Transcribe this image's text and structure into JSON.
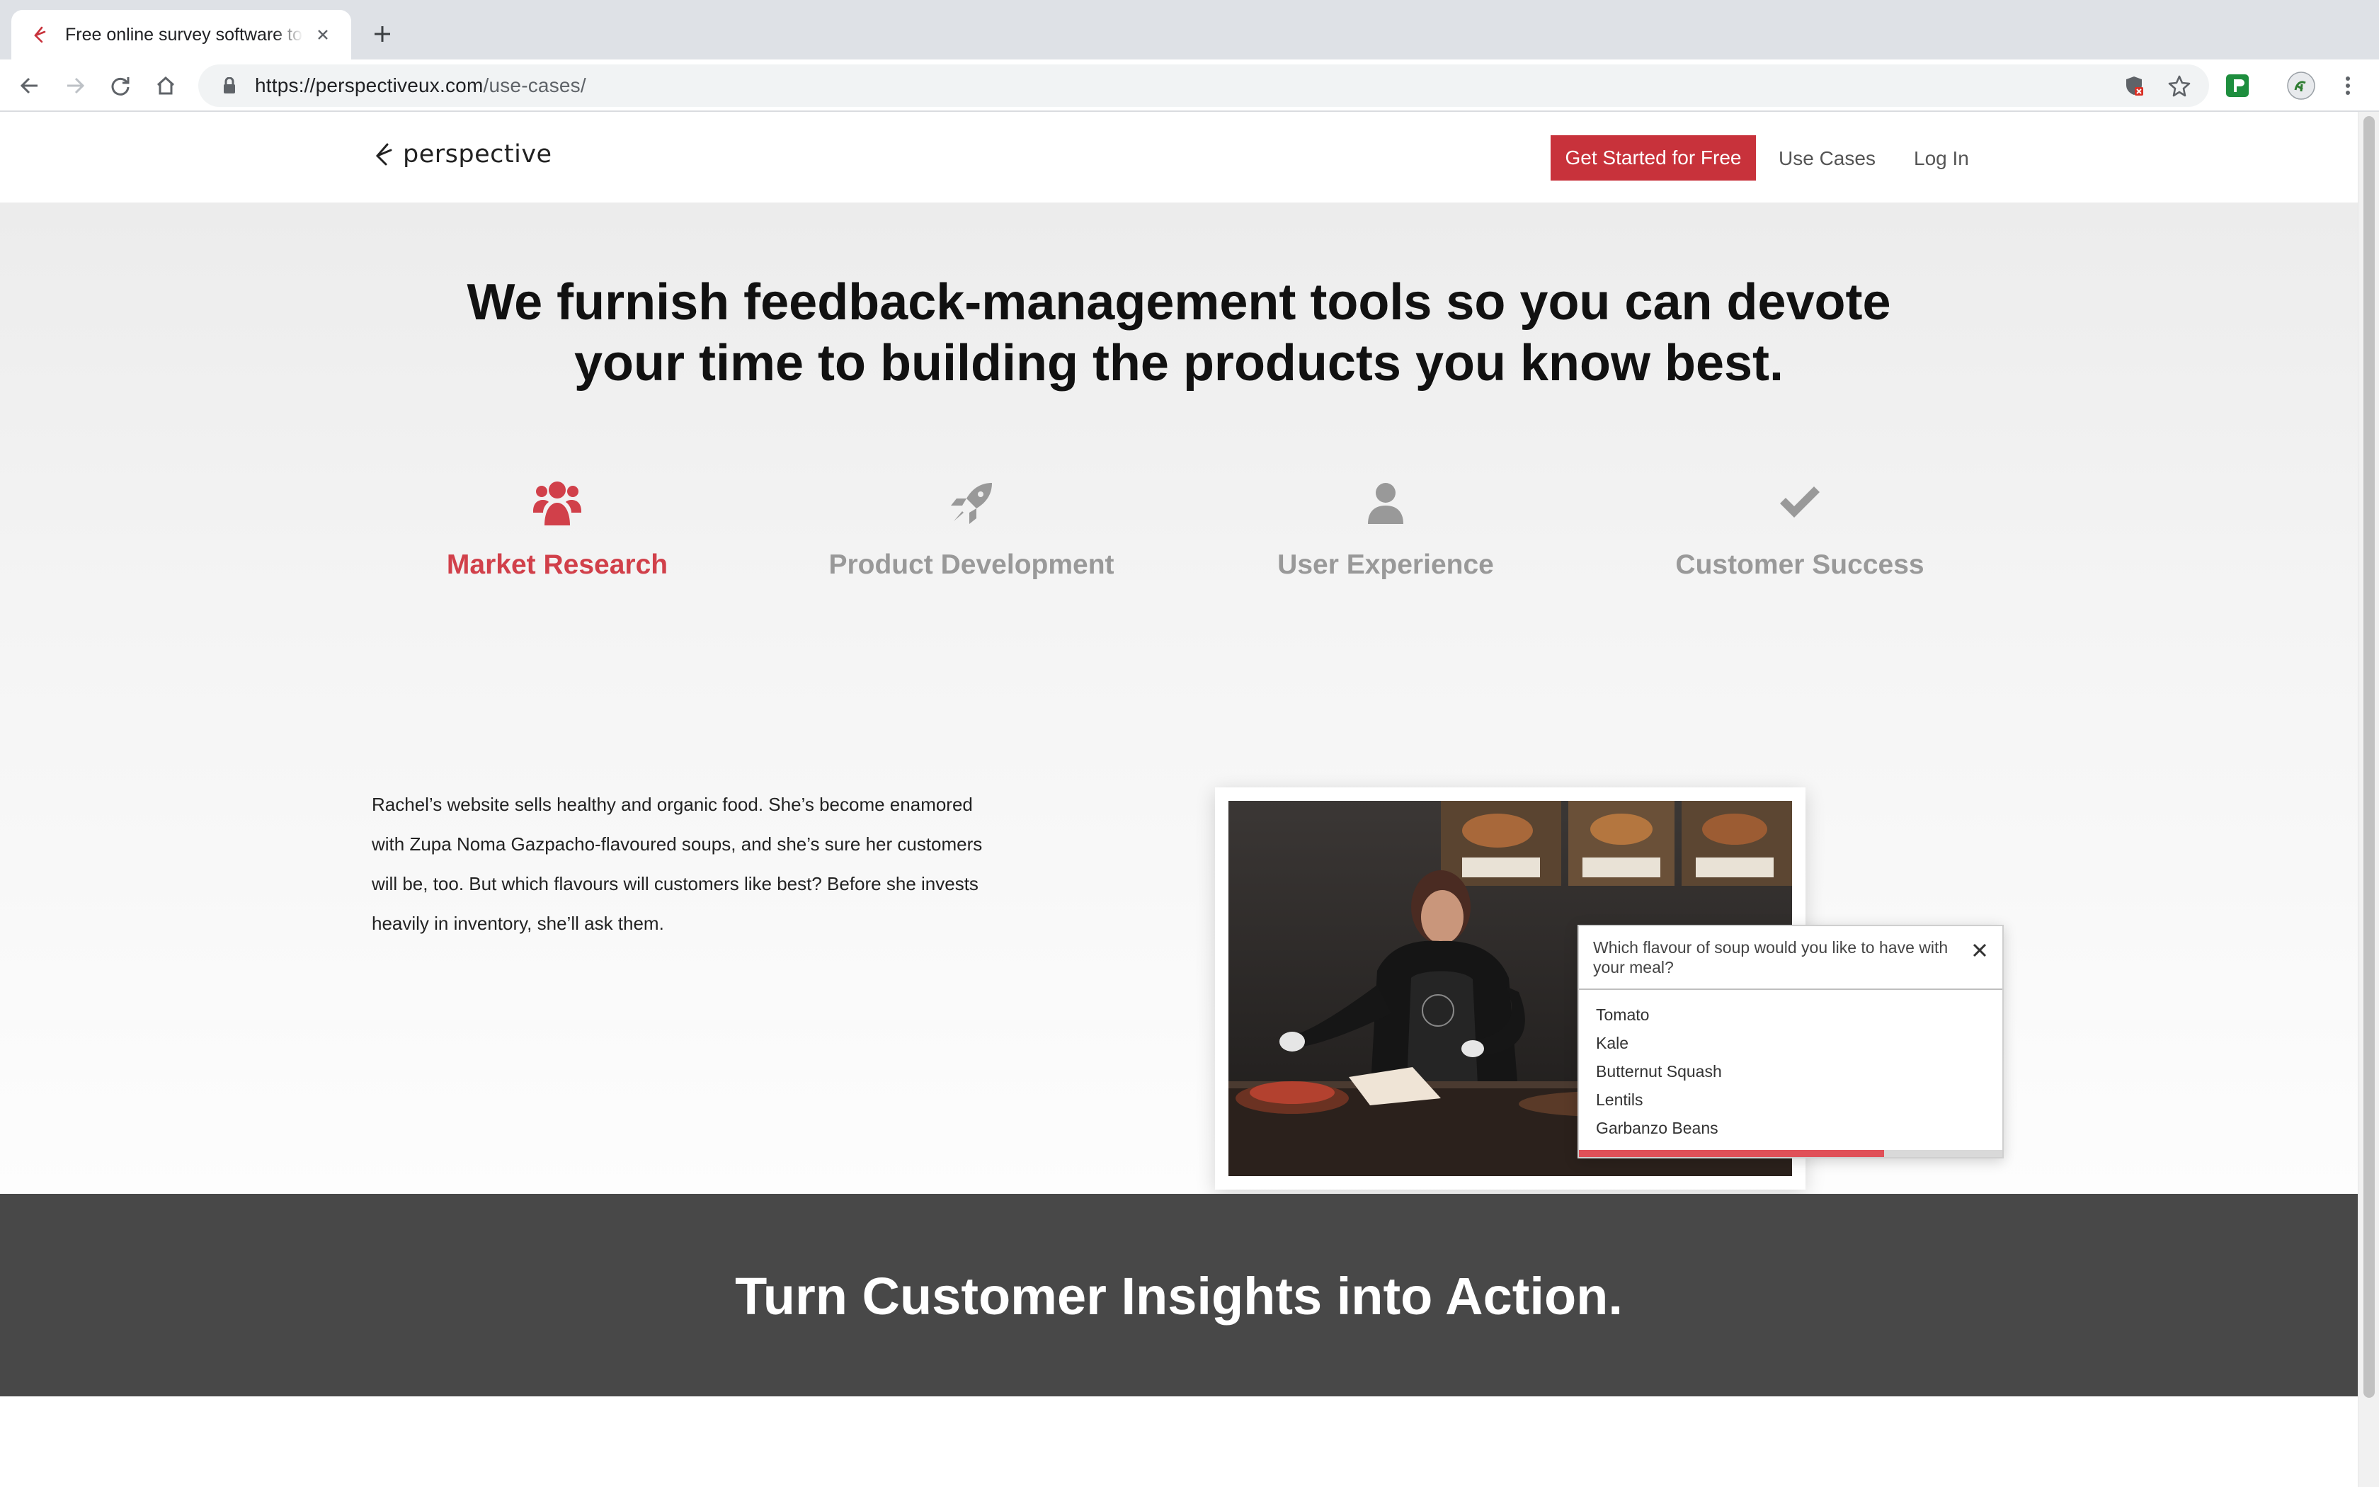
{
  "browser": {
    "tab_title": "Free online survey software to",
    "url_host": "https://perspectiveux.com",
    "url_path": "/use-cases/",
    "accent_color": "#c8323b"
  },
  "header": {
    "logo_text": "perspective",
    "cta_label": "Get Started for Free",
    "nav": [
      "Use Cases",
      "Log In"
    ]
  },
  "hero": {
    "headline_line1": "We furnish feedback-management tools so you can devote",
    "headline_line2": "your time to building the products you know best."
  },
  "categories": [
    {
      "label": "Market Research",
      "icon": "users-icon",
      "active": true
    },
    {
      "label": "Product Development",
      "icon": "rocket-icon",
      "active": false
    },
    {
      "label": "User Experience",
      "icon": "user-icon",
      "active": false
    },
    {
      "label": "Customer Success",
      "icon": "checkmark-icon",
      "active": false
    }
  ],
  "story": {
    "line1": "Rachel’s website sells healthy and organic food. She’s become enamored",
    "line2": "with Zupa Noma Gazpacho-flavoured soups, and she’s sure her customers",
    "line3": "will be, too. But which flavours will customers like best? Before she invests",
    "line4": "heavily in inventory, she’ll ask them."
  },
  "survey": {
    "question": "Which flavour of soup would you like to have with your meal?",
    "options": [
      "Tomato",
      "Kale",
      "Butternut Squash",
      "Lentils",
      "Garbanzo Beans"
    ],
    "progress_fraction": 0.72,
    "progress_color": "#e05058"
  },
  "banner": {
    "text": "Turn Customer Insights into Action."
  }
}
